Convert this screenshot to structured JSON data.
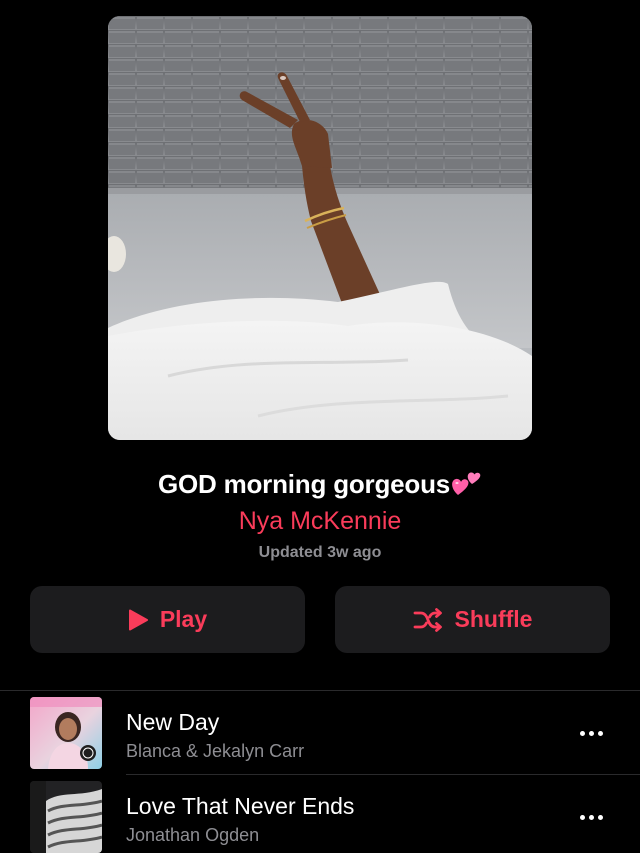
{
  "playlist": {
    "title": "GOD morning gorgeous",
    "title_emoji": "pink-two-hearts-emoji",
    "curator": "Nya McKennie",
    "updated": "Updated 3w ago",
    "artwork": "hand-peace-sign-from-bed-photo"
  },
  "actions": {
    "play_label": "Play",
    "play_icon": "play-triangle-icon",
    "shuffle_label": "Shuffle",
    "shuffle_icon": "shuffle-icon"
  },
  "tracks": [
    {
      "title": "New Day",
      "artist": "Blanca & Jekalyn Carr",
      "artwork": "new-day-album-art"
    },
    {
      "title": "Love That Never Ends",
      "artist": "Jonathan Ogden",
      "artwork": "love-that-never-ends-album-art"
    }
  ],
  "colors": {
    "background": "#000000",
    "accent": "#fa3c5a",
    "button_bg": "#1c1c1e",
    "secondary_text": "#8e8e93"
  }
}
